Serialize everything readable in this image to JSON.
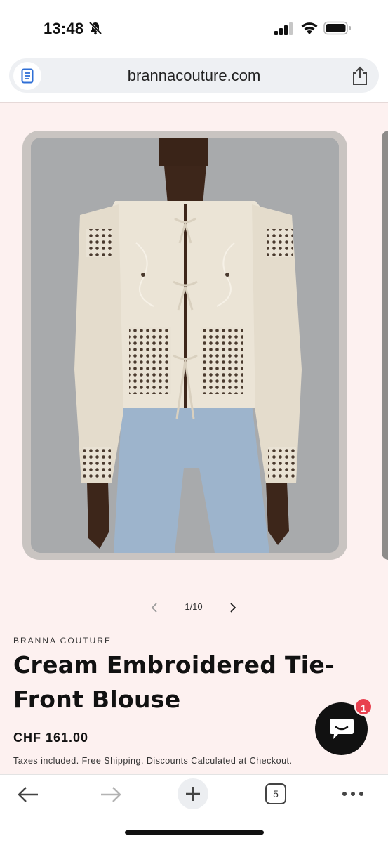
{
  "status_bar": {
    "time": "13:48",
    "icons": [
      "bell-slash-icon",
      "cellular-signal-icon",
      "wifi-icon",
      "battery-icon"
    ]
  },
  "browser": {
    "url": "brannacouture.com",
    "reader_icon": "reader-mode-icon",
    "share_icon": "share-icon"
  },
  "gallery": {
    "counter": "1/10",
    "prev_icon": "chevron-left-icon",
    "next_icon": "chevron-right-icon"
  },
  "product": {
    "vendor": "BRANNA COUTURE",
    "title": "Cream Embroidered Tie-Front Blouse",
    "price": "CHF 161.00",
    "tax_note": "Taxes included. Free Shipping. Discounts Calculated at Checkout."
  },
  "chat": {
    "badge_count": "1",
    "icon": "chat-bubble-icon"
  },
  "toolbar": {
    "tab_count": "5",
    "icons": [
      "back-arrow-icon",
      "forward-arrow-icon",
      "plus-icon",
      "tabs-icon",
      "more-icon"
    ]
  },
  "colors": {
    "page_background": "#fdf1f0",
    "chat_button": "#111111",
    "badge": "#e8404f"
  }
}
